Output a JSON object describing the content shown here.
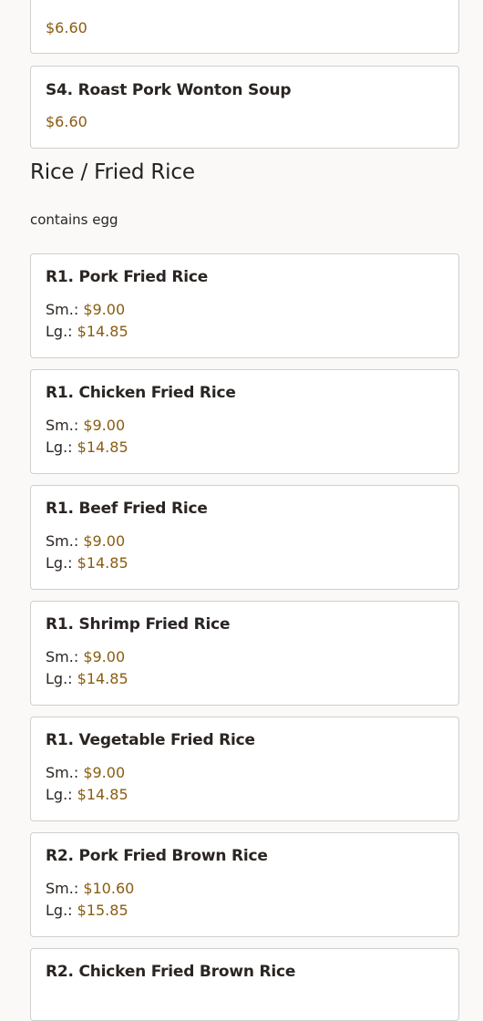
{
  "previous_items": [
    {
      "price": "$6.60"
    },
    {
      "name": "S4. Roast Pork Wonton Soup",
      "price": "$6.60"
    }
  ],
  "section": {
    "title": "Rice / Fried Rice",
    "note": "contains egg"
  },
  "items": [
    {
      "name": "R1. Pork Fried Rice",
      "sm_label": "Sm.:",
      "sm_price": "$9.00",
      "lg_label": "Lg.:",
      "lg_price": "$14.85"
    },
    {
      "name": "R1. Chicken Fried Rice",
      "sm_label": "Sm.:",
      "sm_price": "$9.00",
      "lg_label": "Lg.:",
      "lg_price": "$14.85"
    },
    {
      "name": "R1. Beef Fried Rice",
      "sm_label": "Sm.:",
      "sm_price": "$9.00",
      "lg_label": "Lg.:",
      "lg_price": "$14.85"
    },
    {
      "name": "R1. Shrimp Fried Rice",
      "sm_label": "Sm.:",
      "sm_price": "$9.00",
      "lg_label": "Lg.:",
      "lg_price": "$14.85"
    },
    {
      "name": "R1. Vegetable Fried Rice",
      "sm_label": "Sm.:",
      "sm_price": "$9.00",
      "lg_label": "Lg.:",
      "lg_price": "$14.85"
    },
    {
      "name": "R2. Pork Fried Brown Rice",
      "sm_label": "Sm.:",
      "sm_price": "$10.60",
      "lg_label": "Lg.:",
      "lg_price": "$15.85"
    },
    {
      "name": "R2. Chicken Fried Brown Rice"
    }
  ],
  "colors": {
    "price": "#8a5c10",
    "badge": "#c4222c",
    "card_border": "#cfcfcf",
    "background": "#faf9f7"
  }
}
